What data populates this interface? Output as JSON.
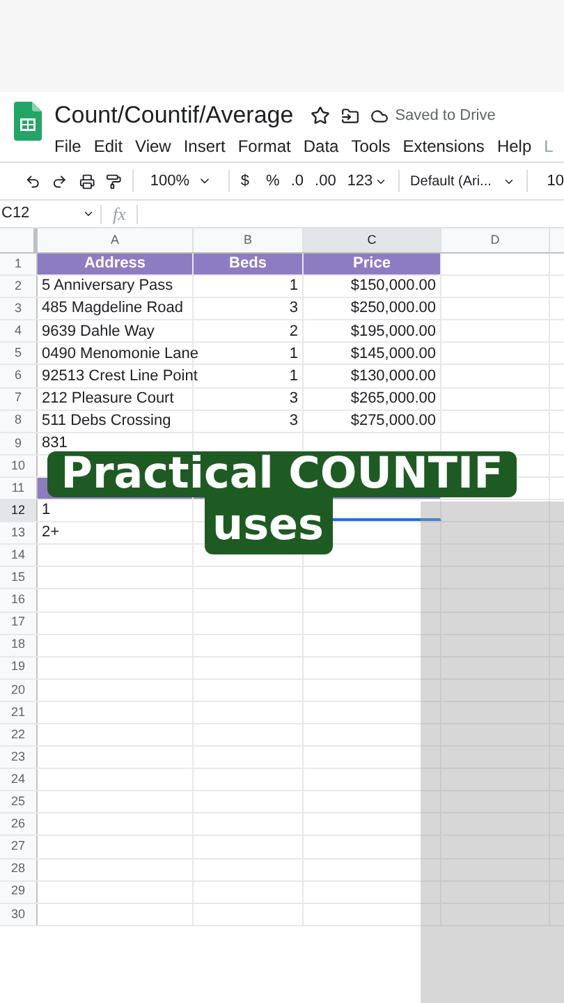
{
  "doc": {
    "title": "Count/Countif/Average",
    "save_status": "Saved to Drive"
  },
  "menu": [
    "File",
    "Edit",
    "View",
    "Insert",
    "Format",
    "Data",
    "Tools",
    "Extensions",
    "Help",
    "L"
  ],
  "toolbar": {
    "zoom": "100%",
    "currency": "$",
    "percent": "%",
    "decrease_decimals": ".0",
    "increase_decimals": ".00",
    "number_format": "123",
    "font": "Default (Ari...",
    "font_size": "10"
  },
  "formula_bar": {
    "cell_ref": "C12",
    "fx": "fx"
  },
  "columns": [
    {
      "label": "A",
      "selected": false
    },
    {
      "label": "B",
      "selected": false
    },
    {
      "label": "C",
      "selected": true
    },
    {
      "label": "D",
      "selected": false
    }
  ],
  "rows": [
    {
      "number": "1",
      "kind": "header",
      "selected": false,
      "cells": [
        "Address",
        "Beds",
        "Price"
      ]
    },
    {
      "number": "2",
      "kind": "data",
      "selected": false,
      "cells": [
        "5 Anniversary Pass",
        "1",
        "$150,000.00"
      ]
    },
    {
      "number": "3",
      "kind": "data",
      "selected": false,
      "cells": [
        "485 Magdeline Road",
        "3",
        "$250,000.00"
      ]
    },
    {
      "number": "4",
      "kind": "data",
      "selected": false,
      "cells": [
        "9639 Dahle Way",
        "2",
        "$195,000.00"
      ]
    },
    {
      "number": "5",
      "kind": "data",
      "selected": false,
      "cells": [
        "0490 Menomonie Lane",
        "1",
        "$145,000.00"
      ]
    },
    {
      "number": "6",
      "kind": "data",
      "selected": false,
      "cells": [
        "92513 Crest Line Point",
        "1",
        "$130,000.00"
      ]
    },
    {
      "number": "7",
      "kind": "data",
      "selected": false,
      "cells": [
        "212 Pleasure Court",
        "3",
        "$265,000.00"
      ]
    },
    {
      "number": "8",
      "kind": "data",
      "selected": false,
      "cells": [
        "511 Debs Crossing",
        "3",
        "$275,000.00"
      ]
    },
    {
      "number": "9",
      "kind": "data",
      "selected": false,
      "cells": [
        "831"
      ]
    },
    {
      "number": "10",
      "kind": "data",
      "selected": false
    },
    {
      "number": "11",
      "kind": "header",
      "selected": false
    },
    {
      "number": "12",
      "kind": "data",
      "selected": true,
      "cells": [
        "1"
      ]
    },
    {
      "number": "13",
      "kind": "data",
      "selected": false,
      "cells": [
        "2+"
      ]
    },
    {
      "number": "14",
      "kind": "data",
      "selected": false
    },
    {
      "number": "15",
      "kind": "data",
      "selected": false
    },
    {
      "number": "16",
      "kind": "data",
      "selected": false
    },
    {
      "number": "17",
      "kind": "data",
      "selected": false
    },
    {
      "number": "18",
      "kind": "data",
      "selected": false
    },
    {
      "number": "19",
      "kind": "data",
      "selected": false
    },
    {
      "number": "20",
      "kind": "data",
      "selected": false
    },
    {
      "number": "21",
      "kind": "data",
      "selected": false
    },
    {
      "number": "22",
      "kind": "data",
      "selected": false
    },
    {
      "number": "23",
      "kind": "data",
      "selected": false
    },
    {
      "number": "24",
      "kind": "data",
      "selected": false
    },
    {
      "number": "25",
      "kind": "data",
      "selected": false
    },
    {
      "number": "26",
      "kind": "data",
      "selected": false
    },
    {
      "number": "27",
      "kind": "data",
      "selected": false
    },
    {
      "number": "28",
      "kind": "data",
      "selected": false
    },
    {
      "number": "29",
      "kind": "data",
      "selected": false
    },
    {
      "number": "30",
      "kind": "data",
      "selected": false
    }
  ],
  "caption": [
    "Practical COUNTIF",
    "uses"
  ]
}
